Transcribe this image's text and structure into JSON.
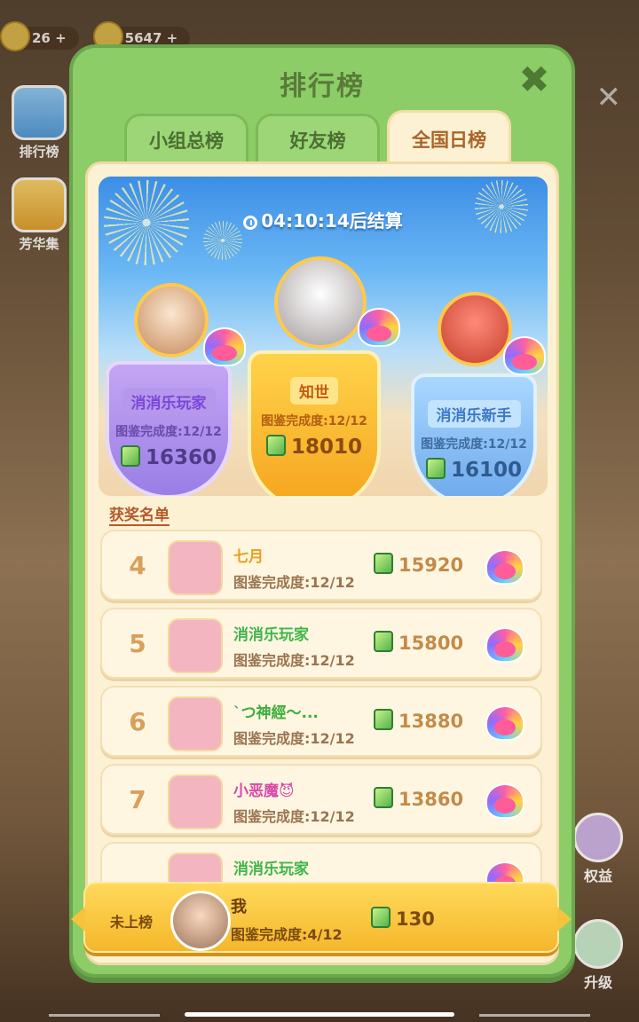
{
  "background": {
    "hud_values": [
      "26",
      "5647"
    ],
    "side_buttons": [
      "排行榜",
      "芳华集"
    ],
    "right_buttons": [
      "权益",
      "升级"
    ]
  },
  "modal": {
    "title": "排行榜",
    "tabs": [
      "小组总榜",
      "好友榜",
      "全国日榜"
    ],
    "active_tab": "全国日榜"
  },
  "countdown": {
    "time": "04:10:14",
    "suffix": "后结算"
  },
  "progress_label": "图鉴完成度:",
  "podium": [
    {
      "rank": 1,
      "name": "知世",
      "progress": "12/12",
      "score": "18010"
    },
    {
      "rank": 2,
      "name": "消消乐玩家",
      "progress": "12/12",
      "score": "16360"
    },
    {
      "rank": 3,
      "name": "消消乐新手",
      "progress": "12/12",
      "score": "16100"
    }
  ],
  "award_list_title": "获奖名单",
  "list": [
    {
      "rank": "4",
      "name": "七月",
      "progress": "图鉴完成度:12/12",
      "score": "15920",
      "name_color": "#e8a11e"
    },
    {
      "rank": "5",
      "name": "消消乐玩家",
      "progress": "图鉴完成度:12/12",
      "score": "15800",
      "name_color": "#3fb54a"
    },
    {
      "rank": "6",
      "name": "`つ神經～...",
      "progress": "图鉴完成度:12/12",
      "score": "13880",
      "name_color": "#3fae3c"
    },
    {
      "rank": "7",
      "name": "小恶魔😈",
      "progress": "图鉴完成度:12/12",
      "score": "13860",
      "name_color": "#d84aa8"
    },
    {
      "rank": "",
      "name": "消消乐玩家",
      "progress": "",
      "score": "",
      "name_color": "#3fb54a"
    }
  ],
  "me": {
    "status": "未上榜",
    "name": "我",
    "progress": "图鉴完成度:4/12",
    "score": "130"
  },
  "colors": {
    "modal_green": "#8ccd68",
    "panel_cream": "#fdf1d3",
    "gold": "#f5b72b"
  }
}
